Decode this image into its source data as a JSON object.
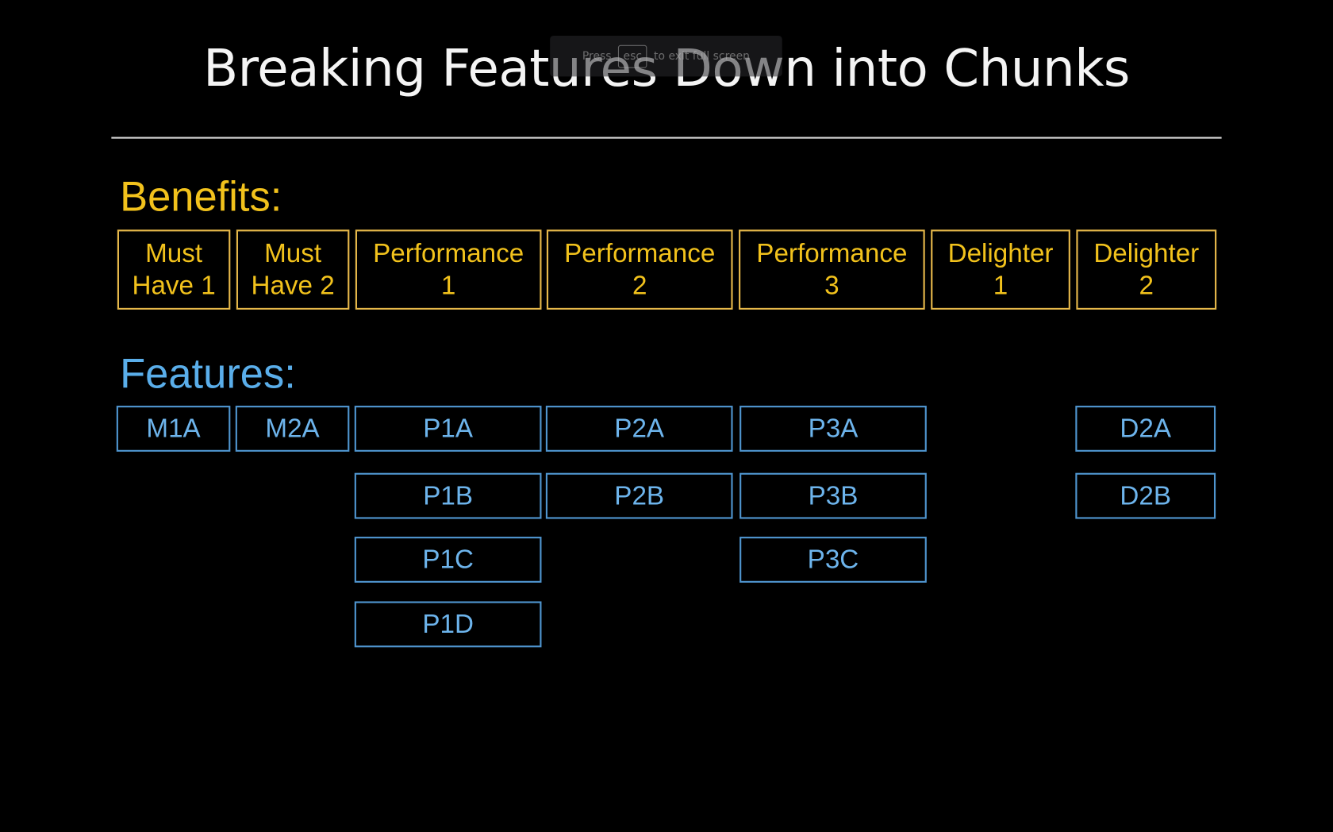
{
  "slide": {
    "title": "Breaking Features Down into Chunks",
    "benefits_label": "Benefits:",
    "features_label": "Features:",
    "colors": {
      "benefit": "#f2c21c",
      "feature": "#6db4ec",
      "background": "#000000"
    },
    "benefits": [
      "Must\nHave 1",
      "Must\nHave 2",
      "Performance\n1",
      "Performance\n2",
      "Performance\n3",
      "Delighter\n1",
      "Delighter\n2"
    ],
    "features": {
      "M1A": "M1A",
      "M2A": "M2A",
      "P1A": "P1A",
      "P1B": "P1B",
      "P1C": "P1C",
      "P1D": "P1D",
      "P2A": "P2A",
      "P2B": "P2B",
      "P3A": "P3A",
      "P3B": "P3B",
      "P3C": "P3C",
      "D2A": "D2A",
      "D2B": "D2B"
    }
  },
  "fullscreen_toast": {
    "press": "Press",
    "key": "esc",
    "suffix": "to exit full screen"
  }
}
